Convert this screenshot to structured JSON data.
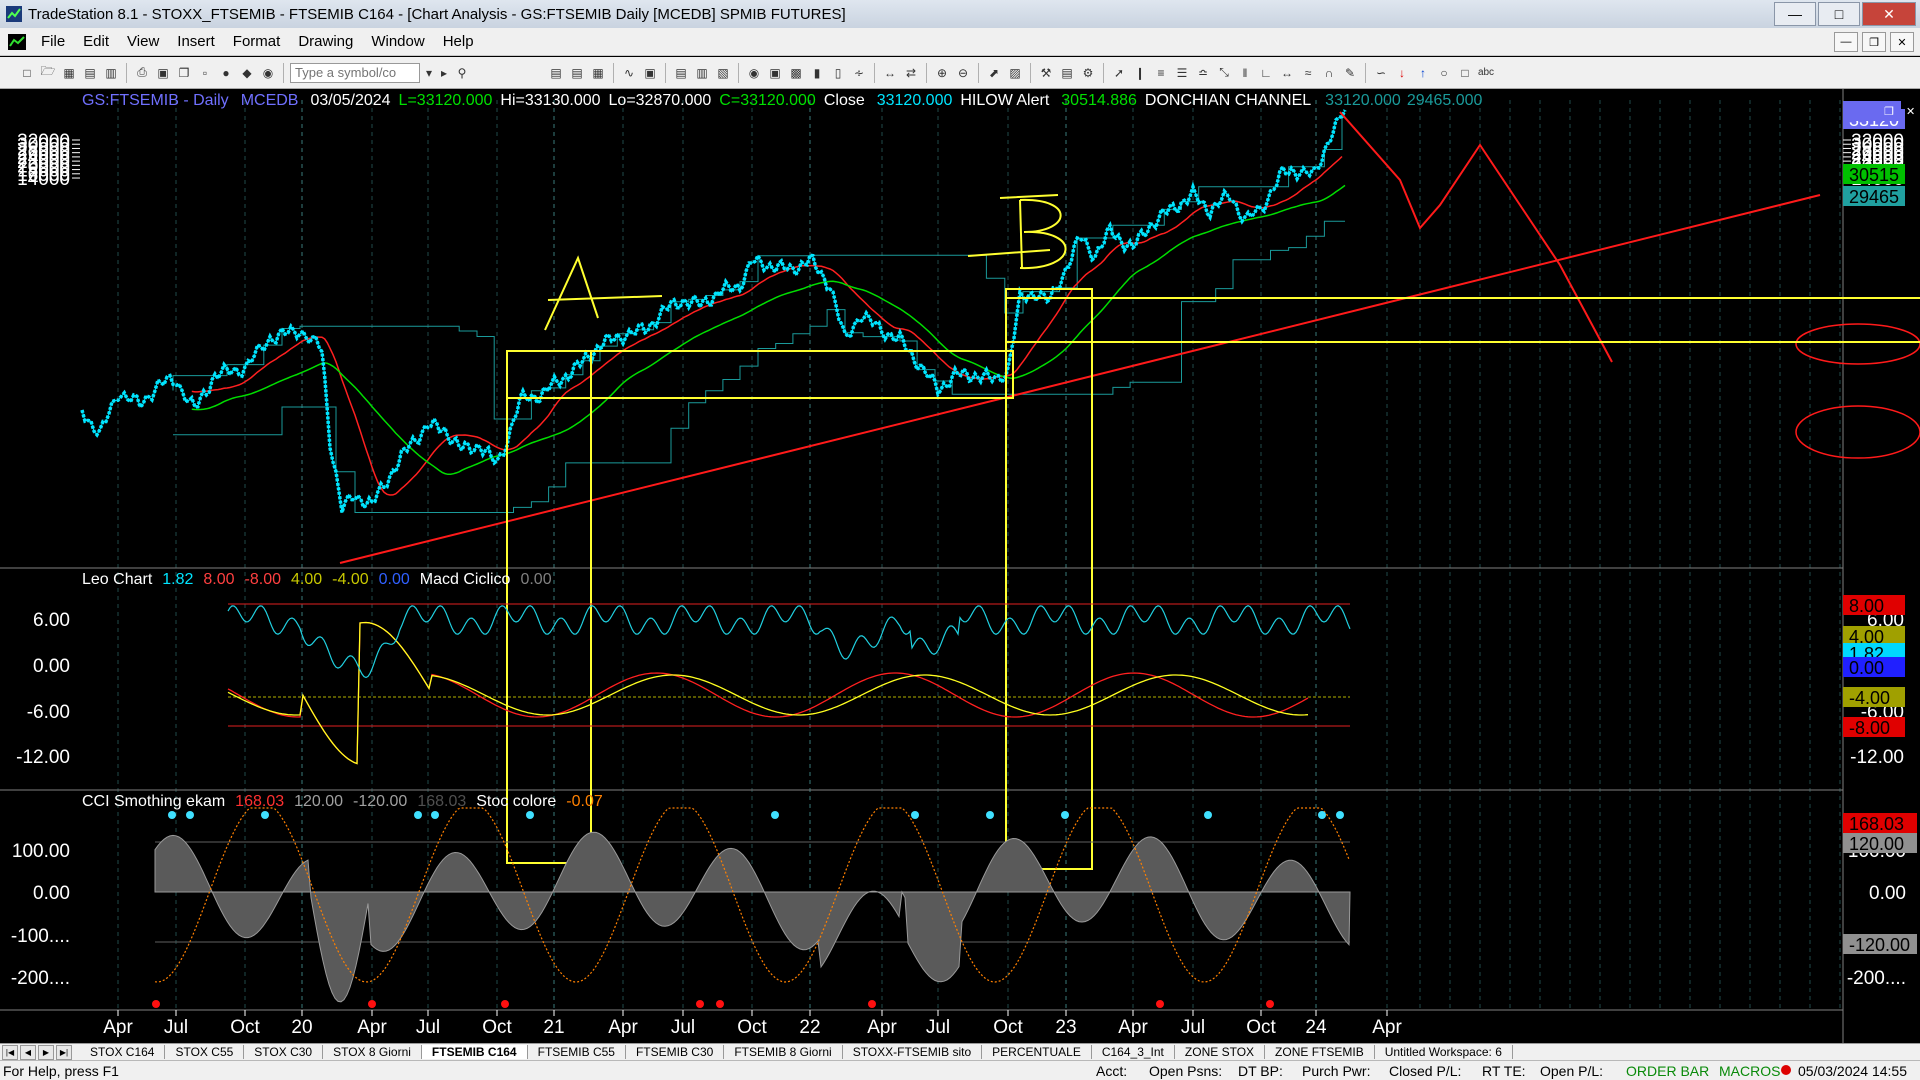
{
  "window": {
    "title": "TradeStation 8.1 - STOXX_FTSEMIB - FTSEMIB C164 - [Chart Analysis - GS:FTSEMIB  Daily  [MCEDB] SPMIB FUTURES]"
  },
  "menu": [
    "File",
    "Edit",
    "View",
    "Insert",
    "Format",
    "Drawing",
    "Window",
    "Help"
  ],
  "toolbar": {
    "symbol_placeholder": "Type a symbol/co"
  },
  "header": {
    "symbol": "GS:FTSEMIB - Daily",
    "feed": "MCEDB",
    "date": "03/05/2024",
    "last": "L=33120.000",
    "hi": "Hi=33130.000",
    "lo": "Lo=32870.000",
    "close_c": "C=33120.000",
    "close_lbl": "Close",
    "close_val": "33120.000",
    "hilow_lbl": "HILOW Alert",
    "hilow_val": "30514.886",
    "donch_lbl": "DONCHIAN CHANNEL",
    "donch_v1": "33120.000",
    "donch_v2": "29465.000"
  },
  "price_axis": {
    "ticks": [
      "32000",
      "30000",
      "28000",
      "26000",
      "24000",
      "22000",
      "20000",
      "18000",
      "16000",
      "14000"
    ],
    "values": [
      32000,
      30000,
      28000,
      26000,
      24000,
      22000,
      20000,
      18000,
      16000,
      14000
    ]
  },
  "price_right_tags": [
    {
      "text": "30515",
      "bg": "#00c000",
      "fg": "#000000"
    },
    {
      "text": "29465",
      "bg": "#20a0a0",
      "fg": "#000000"
    },
    {
      "text": "33120",
      "bg": "#6a6af0",
      "fg": "#ffffff"
    }
  ],
  "macd_panel": {
    "legend": [
      {
        "text": "Leo Chart",
        "color": "#ffffff"
      },
      {
        "text": "1.82",
        "color": "#00e5ff"
      },
      {
        "text": "8.00",
        "color": "#ff4040"
      },
      {
        "text": "-8.00",
        "color": "#ff4040"
      },
      {
        "text": "4.00",
        "color": "#c8c800"
      },
      {
        "text": "-4.00",
        "color": "#c8c800"
      },
      {
        "text": "0.00",
        "color": "#3060ff"
      },
      {
        "text": "Macd Ciclico",
        "color": "#ffffff"
      },
      {
        "text": "0.00",
        "color": "#808080"
      }
    ],
    "ticks": [
      "6.00",
      "0.00",
      "-6.00",
      "-12.00"
    ],
    "tags": [
      {
        "text": "8.00",
        "bg": "#e00000",
        "fg": "#000000"
      },
      {
        "text": "4.00",
        "bg": "#a0a000",
        "fg": "#000000"
      },
      {
        "text": "1.82",
        "bg": "#00d8ff",
        "fg": "#000000"
      },
      {
        "text": "0.00",
        "bg": "#2020ff",
        "fg": "#000000"
      },
      {
        "text": "-4.00",
        "bg": "#a0a000",
        "fg": "#000000"
      },
      {
        "text": "-8.00",
        "bg": "#e00000",
        "fg": "#000000"
      }
    ]
  },
  "cci_panel": {
    "legend": [
      {
        "text": "CCI Smothing ekam",
        "color": "#ffffff"
      },
      {
        "text": "168.03",
        "color": "#ff3030"
      },
      {
        "text": "120.00",
        "color": "#a0a0a0"
      },
      {
        "text": "-120.00",
        "color": "#a0a0a0"
      },
      {
        "text": "168.03",
        "color": "#505050"
      },
      {
        "text": "Stoc colore",
        "color": "#ffffff"
      },
      {
        "text": "-0.07",
        "color": "#ff8000"
      }
    ],
    "ticks": [
      "100.00",
      "0.00",
      "-100....",
      "-200...."
    ],
    "tags": [
      {
        "text": "168.03",
        "bg": "#e00000",
        "fg": "#000000"
      },
      {
        "text": "120.00",
        "bg": "#909090",
        "fg": "#000000"
      },
      {
        "text": "-120.00",
        "bg": "#909090",
        "fg": "#000000"
      }
    ]
  },
  "time_axis": {
    "labels": [
      "Apr",
      "Jul",
      "Oct",
      "20",
      "Apr",
      "Jul",
      "Oct",
      "21",
      "Apr",
      "Jul",
      "Oct",
      "22",
      "Apr",
      "Jul",
      "Oct",
      "23",
      "Apr",
      "Jul",
      "Oct",
      "24",
      "Apr"
    ]
  },
  "annotations": {
    "letter_a": "A",
    "letter_b": "B"
  },
  "tabs": [
    "STOX C164",
    "STOX C55",
    "STOX  C30",
    "STOX  8 Giorni",
    "FTSEMIB C164",
    "FTSEMIB C55",
    "FTSEMIB C30",
    "FTSEMIB  8 Giorni",
    "STOXX-FTSEMIB sito",
    "PERCENTUALE",
    "C164_3_Int",
    "ZONE STOX",
    "ZONE FTSEMIB",
    "Untitled Workspace:  6"
  ],
  "active_tab": 4,
  "status": {
    "help": "For Help, press F1",
    "acct": "Acct:",
    "open_psns": "Open Psns:",
    "dt_bp": "DT BP:",
    "purch_pwr": "Purch Pwr:",
    "closed_pl": "Closed P/L:",
    "rt_te": "RT TE:",
    "open_pl": "Open P/L:",
    "order_bar": "ORDER BAR",
    "macros": "MACROS",
    "datetime": "05/03/2024 14:55"
  },
  "colors": {
    "price": "#00e5ff",
    "green_ma": "#00dd00",
    "red_line": "#ff2020",
    "channel": "#1a9a9a",
    "annot": "#ffff30",
    "grid": "#2c5a5a"
  }
}
